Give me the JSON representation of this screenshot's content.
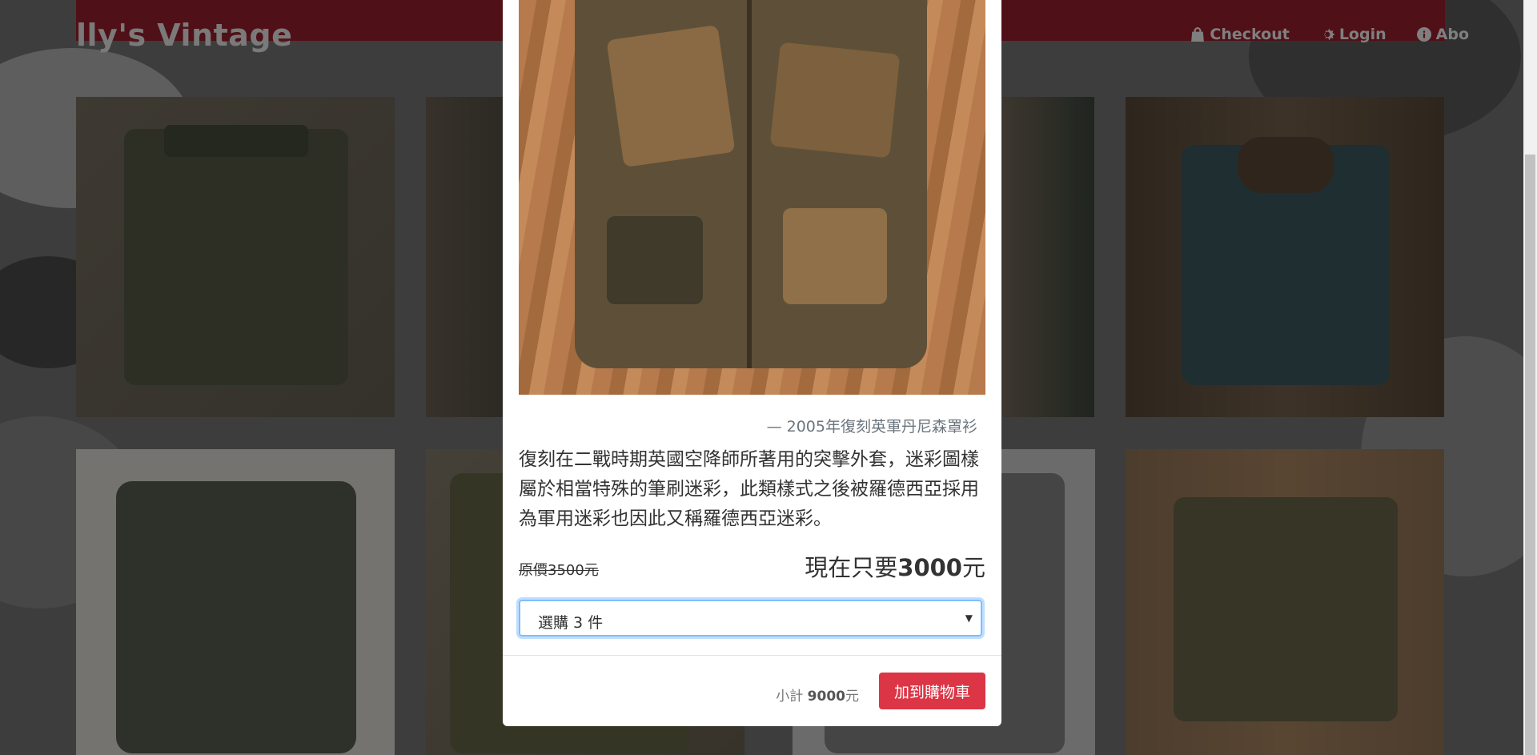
{
  "navbar": {
    "brand": "lly's Vintage",
    "links": [
      {
        "label": "Checkout",
        "icon": "shopping-bag-icon"
      },
      {
        "label": "Login",
        "icon": "gear-icon"
      },
      {
        "label": "Abo",
        "icon": "info-circle-icon"
      }
    ]
  },
  "modal": {
    "caption": "— 2005年復刻英軍丹尼森罩衫",
    "description": "復刻在二戰時期英國空降師所著用的突擊外套，迷彩圖樣屬於相當特殊的筆刷迷彩，此類樣式之後被羅德西亞採用為軍用迷彩也因此又稱羅德西亞迷彩。",
    "original_price": "原價3500元",
    "now_price_prefix": "現在只要",
    "now_price_value": "3000",
    "now_price_suffix": "元",
    "quantity_selected": "選購 3 件",
    "subtotal_label": "小計",
    "subtotal_value": "9000",
    "subtotal_suffix": "元",
    "add_to_cart": "加到購物車"
  },
  "colors": {
    "navbar": "#a0202e",
    "button": "#dc3545",
    "focus": "#80bdff"
  }
}
